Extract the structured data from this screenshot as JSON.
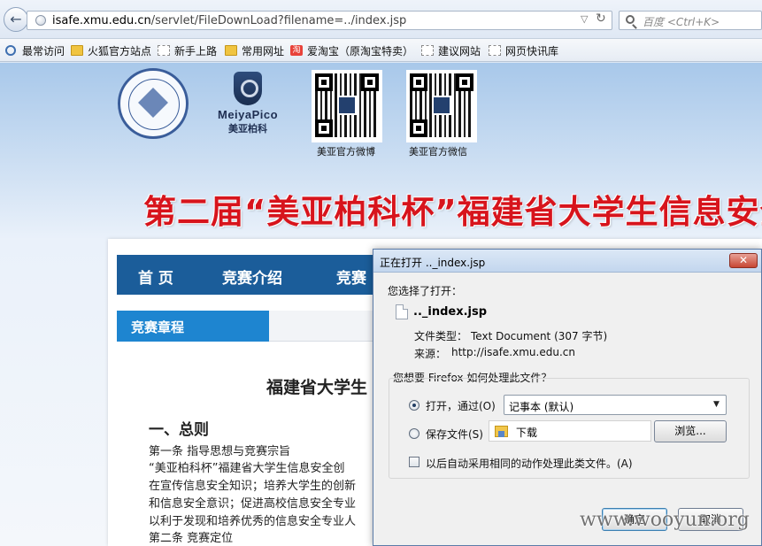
{
  "browser": {
    "url_host": "isafe.xmu.edu.cn",
    "url_path": "/servlet/FileDownLoad?filename=../index.jsp",
    "search_placeholder": "百度 <Ctrl+K>",
    "bookmarks": [
      "最常访问",
      "火狐官方站点",
      "新手上路",
      "常用网址",
      "爱淘宝（原淘宝特卖）",
      "建议网站",
      "网页快讯库"
    ],
    "taobao_glyph": "淘"
  },
  "page": {
    "seal_icon": "university-seal-icon",
    "meiya_brand": "MeiyaPico",
    "meiya_cn": "美亚柏科",
    "qr_weibo_caption": "美亚官方微博",
    "qr_weixin_caption": "美亚官方微信",
    "banner": "第二届“美亚柏科杯”福建省大学生信息安全",
    "nav": [
      "首 页",
      "竞赛介绍",
      "竞赛"
    ],
    "section_tab": "竞赛章程",
    "doc_title": "福建省大学生",
    "doc_h2": "一、总则",
    "doc_lines": [
      "第一条 指导思想与竞赛宗旨",
      "“美亚柏科杯”福建省大学生信息安全创",
      "在宣传信息安全知识；培养大学生的创新",
      "和信息安全意识；促进高校信息安全专业",
      "以利于发现和培养优秀的信息安全专业人",
      "第二条 竞赛定位"
    ]
  },
  "dialog": {
    "title": "正在打开 .._index.jsp",
    "close_glyph": "✕",
    "chose_label": "您选择了打开：",
    "file_name": ".._index.jsp",
    "type_label": "文件类型：",
    "type_value": "Text Document (307 字节)",
    "source_label": "来源：",
    "source_value": "http://isafe.xmu.edu.cn",
    "question": "您想要 Firefox 如何处理此文件？",
    "open_with_label": "打开，通过(O)",
    "open_with_app": "记事本 (默认)",
    "save_label": "保存文件(S)",
    "save_folder": "下载",
    "browse_label": "浏览...",
    "remember_label": "以后自动采用相同的动作处理此类文件。(A)",
    "ok_label": "确定",
    "cancel_label": "取消"
  },
  "watermark": "www.wooyun.org",
  "colors": {
    "nav_blue": "#1b5d9a",
    "tab_blue": "#1e85d0",
    "banner_red": "#d7141c"
  }
}
